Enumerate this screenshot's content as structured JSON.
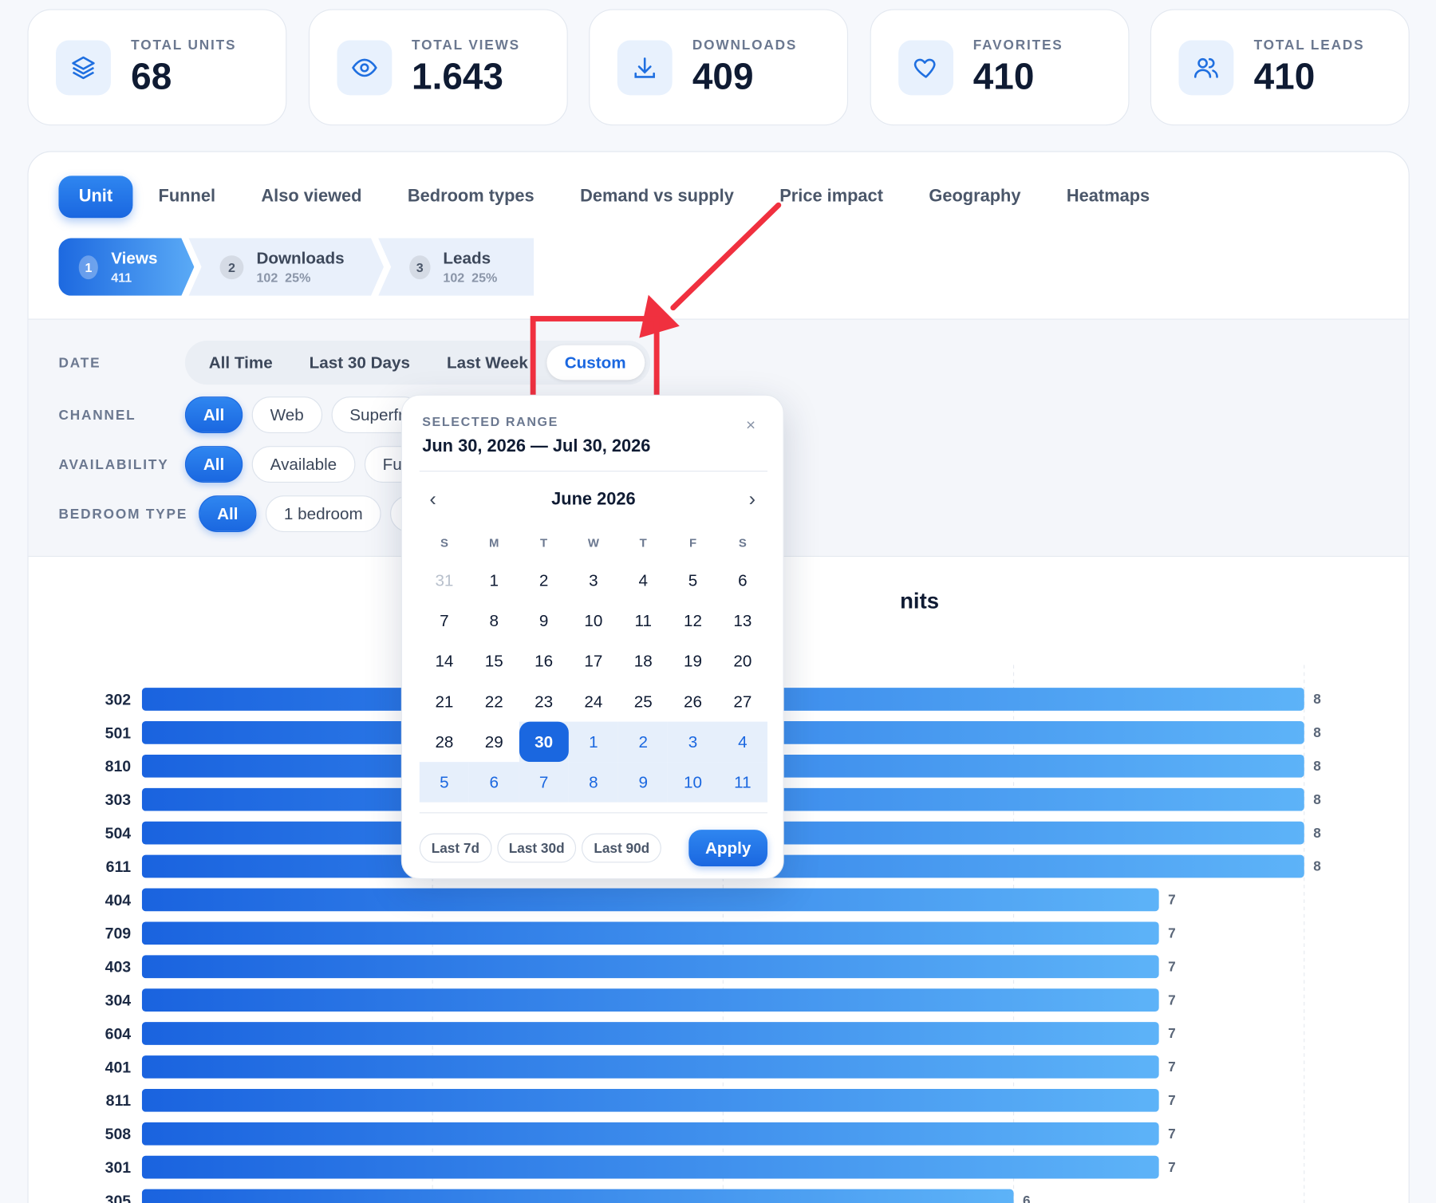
{
  "stats": [
    {
      "label": "TOTAL UNITS",
      "value": "68",
      "icon": "layers-icon"
    },
    {
      "label": "TOTAL VIEWS",
      "value": "1.643",
      "icon": "eye-icon"
    },
    {
      "label": "DOWNLOADS",
      "value": "409",
      "icon": "download-icon"
    },
    {
      "label": "FAVORITES",
      "value": "410",
      "icon": "heart-icon"
    },
    {
      "label": "TOTAL LEADS",
      "value": "410",
      "icon": "users-icon"
    }
  ],
  "tabs": [
    "Unit",
    "Funnel",
    "Also viewed",
    "Bedroom types",
    "Demand vs supply",
    "Price impact",
    "Geography",
    "Heatmaps"
  ],
  "steps": [
    {
      "num": "1",
      "title": "Views",
      "sub": "411"
    },
    {
      "num": "2",
      "title": "Downloads",
      "sub": "102  25%"
    },
    {
      "num": "3",
      "title": "Leads",
      "sub": "102  25%"
    }
  ],
  "filters": {
    "date_label": "DATE",
    "date_options": [
      "All Time",
      "Last 30 Days",
      "Last Week",
      "Custom"
    ],
    "channel_label": "CHANNEL",
    "channel_options": [
      "All",
      "Web",
      "Superfr"
    ],
    "availability_label": "AVAILABILITY",
    "availability_options": [
      "All",
      "Available",
      "Fu"
    ],
    "bedroom_label": "BEDROOM TYPE",
    "bedroom_options": [
      "All",
      "1 bedroom"
    ]
  },
  "chart_title_visible": "nits",
  "calendar": {
    "label": "SELECTED RANGE",
    "range": "Jun 30, 2026 — Jul 30, 2026",
    "close": "×",
    "month": "June 2026",
    "prev": "‹",
    "next": "›",
    "weekdays": [
      "S",
      "M",
      "T",
      "W",
      "T",
      "F",
      "S"
    ],
    "quick": [
      "Last 7d",
      "Last 30d",
      "Last 90d"
    ],
    "apply": "Apply"
  },
  "chart_data": {
    "type": "bar",
    "orientation": "horizontal",
    "categories": [
      "302",
      "501",
      "810",
      "303",
      "504",
      "611",
      "404",
      "709",
      "403",
      "304",
      "604",
      "401",
      "811",
      "508",
      "301",
      "305"
    ],
    "values": [
      8,
      8,
      8,
      8,
      8,
      8,
      7,
      7,
      7,
      7,
      7,
      7,
      7,
      7,
      7,
      6
    ],
    "xlim": [
      0,
      8
    ],
    "colors": {
      "bar_start": "#1a63df",
      "bar_end": "#5db3f8"
    }
  }
}
